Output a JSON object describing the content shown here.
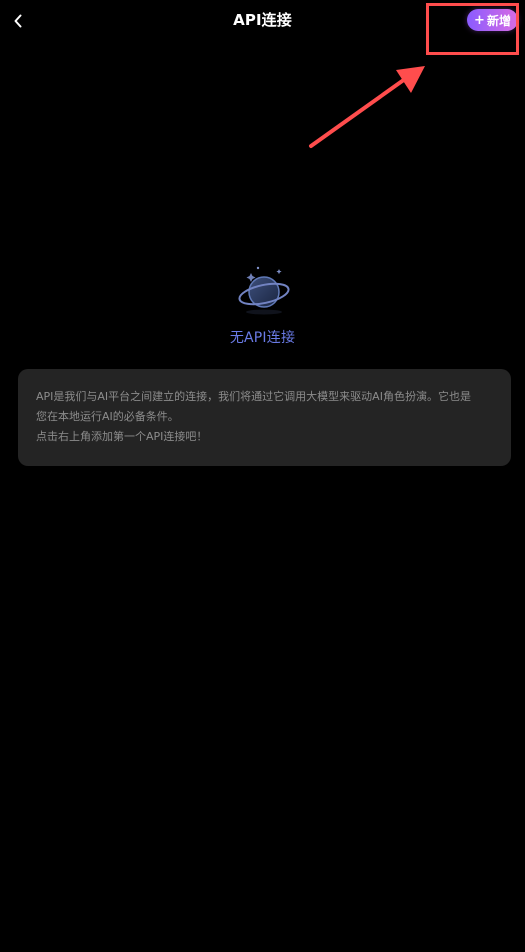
{
  "header": {
    "title": "API连接",
    "back_icon": "chevron-left-icon",
    "add_button": {
      "plus": "+",
      "label": "新增"
    }
  },
  "annotation": {
    "highlight_color": "#ff4d4d"
  },
  "empty_state": {
    "illustration": "planet-icon",
    "label": "无API连接"
  },
  "info_card": {
    "line_1": "API是我们与AI平台之间建立的连接，我们将通过它调用大模型来驱动AI角色扮演。它也是",
    "line_2": "您在本地运行AI的必备条件。",
    "line_3": "点击右上角添加第一个API连接吧！"
  },
  "colors": {
    "background": "#000000",
    "card": "#242424",
    "accent_start": "#8a5cff",
    "accent_end": "#d86be3",
    "empty_label": "#6a7be6"
  }
}
